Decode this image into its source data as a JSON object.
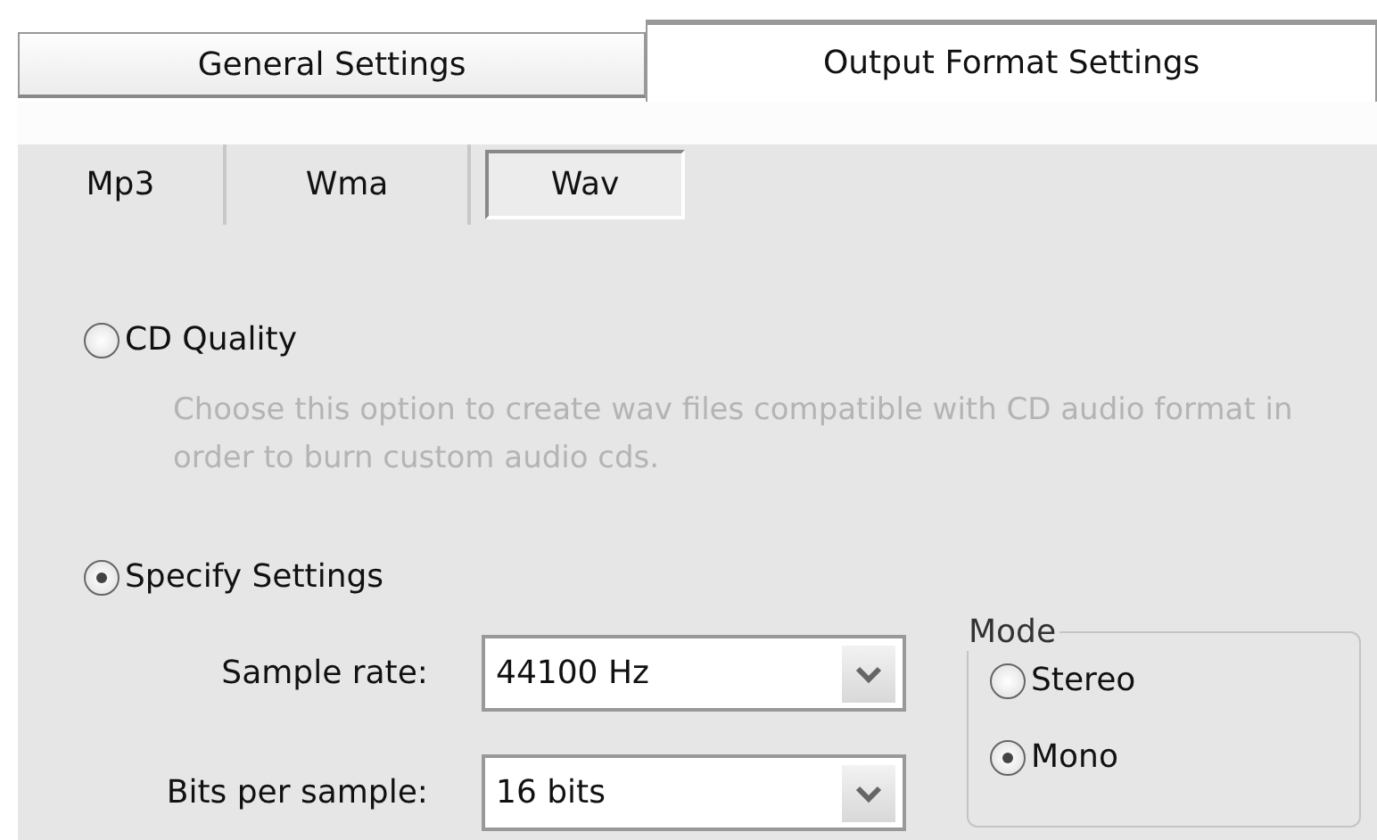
{
  "main_tabs": [
    {
      "label": "General Settings",
      "selected": false
    },
    {
      "label": "Output Format Settings",
      "selected": true
    }
  ],
  "format_tabs": [
    {
      "label": "Mp3",
      "selected": false
    },
    {
      "label": "Wma",
      "selected": false
    },
    {
      "label": "Wav",
      "selected": true
    }
  ],
  "quality_options": [
    {
      "label": "CD Quality",
      "selected": false,
      "description": "Choose this option to create wav files compatible with CD audio format in order to burn custom audio cds."
    },
    {
      "label": "Specify Settings",
      "selected": true
    }
  ],
  "settings": [
    {
      "label": "Sample rate:",
      "value": "44100 Hz"
    },
    {
      "label": "Bits per sample:",
      "value": "16 bits"
    }
  ],
  "mode": {
    "title": "Mode",
    "options": [
      {
        "label": "Stereo",
        "selected": false
      },
      {
        "label": "Mono",
        "selected": true
      }
    ]
  }
}
